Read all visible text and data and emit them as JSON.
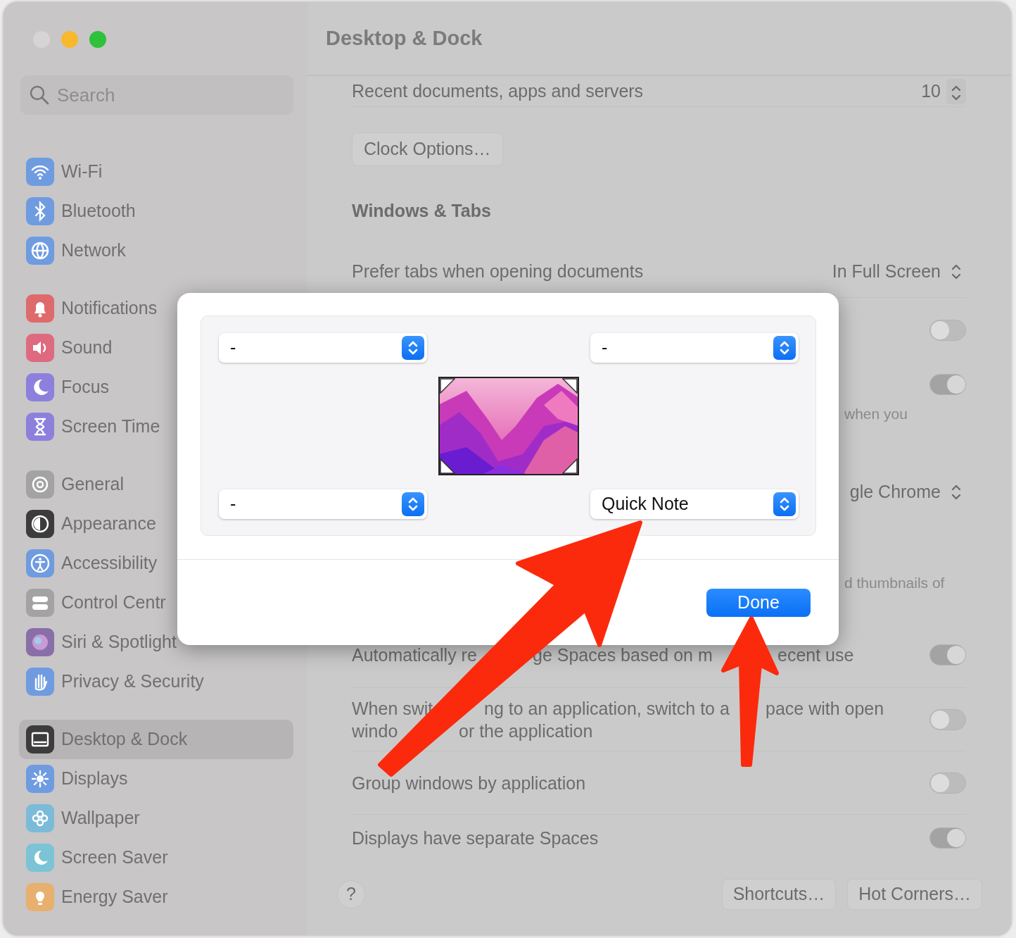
{
  "window": {
    "title": "Desktop & Dock"
  },
  "sidebar": {
    "search": {
      "placeholder": "Search"
    },
    "groups": [
      {
        "items": [
          {
            "label": "Wi-Fi",
            "color": "#6f9be0",
            "selected": false
          },
          {
            "label": "Bluetooth",
            "color": "#6f9be0",
            "selected": false
          },
          {
            "label": "Network",
            "color": "#6f9be0",
            "selected": false
          }
        ]
      },
      {
        "items": [
          {
            "label": "Notifications",
            "color": "#df6a6c",
            "selected": false
          },
          {
            "label": "Sound",
            "color": "#df6a80",
            "selected": false
          },
          {
            "label": "Focus",
            "color": "#8c80dc",
            "selected": false
          },
          {
            "label": "Screen Time",
            "color": "#8c80dc",
            "selected": false
          }
        ]
      },
      {
        "items": [
          {
            "label": "General",
            "color": "#a3a3a3",
            "selected": false
          },
          {
            "label": "Appearance",
            "color": "#3c3c3c",
            "selected": false
          },
          {
            "label": "Accessibility",
            "color": "#6f9be0",
            "selected": false
          },
          {
            "label": "Control Centr",
            "color": "#a3a3a3",
            "selected": false
          },
          {
            "label": "Siri & Spotlight",
            "color": "#8a6ea8",
            "selected": false
          },
          {
            "label": "Privacy & Security",
            "color": "#6f9be0",
            "selected": false
          }
        ]
      },
      {
        "items": [
          {
            "label": "Desktop & Dock",
            "color": "#3c3c3c",
            "selected": true
          },
          {
            "label": "Displays",
            "color": "#6f9be0",
            "selected": false
          },
          {
            "label": "Wallpaper",
            "color": "#7bbbd8",
            "selected": false
          },
          {
            "label": "Screen Saver",
            "color": "#7cc3d6",
            "selected": false
          },
          {
            "label": "Energy Saver",
            "color": "#e8b06e",
            "selected": false
          }
        ]
      }
    ]
  },
  "settings": [
    {
      "kind": "stepper",
      "label": "Recent documents, apps and servers",
      "value": "10"
    },
    {
      "kind": "button",
      "label": "Clock Options…"
    },
    {
      "kind": "heading",
      "label": "Windows & Tabs"
    },
    {
      "kind": "popup",
      "label": "Prefer tabs when opening documents",
      "value": "In Full Screen"
    },
    {
      "kind": "toggle",
      "on": false
    },
    {
      "kind": "toggle",
      "on": true,
      "label_tail": "when you"
    },
    {
      "kind": "popup",
      "value": "gle Chrome"
    },
    {
      "kind": "note",
      "label_tail": "d thumbnails of"
    },
    {
      "kind": "toggle",
      "label_lines": [
        [
          "Automatically re",
          "ge Spaces based on m",
          "ecent use"
        ]
      ],
      "on": true
    },
    {
      "kind": "toggle",
      "label_lines": [
        [
          "When swit",
          "ng to an application, switch to a",
          "pace with open"
        ],
        [
          "windo",
          "or the application"
        ]
      ],
      "on": false
    },
    {
      "kind": "toggle",
      "label": "Group windows by application",
      "on": false
    },
    {
      "kind": "toggle",
      "label": "Displays have separate Spaces",
      "on": true
    }
  ],
  "footer": {
    "help": "?",
    "buttons": [
      "Shortcuts…",
      "Hot Corners…"
    ]
  },
  "dialog": {
    "corners": [
      {
        "value": "-"
      },
      {
        "value": "-"
      },
      {
        "value": "-"
      },
      {
        "value": "Quick Note"
      }
    ],
    "button": "Done"
  },
  "annotations": [
    {
      "kind": "arrow"
    },
    {
      "kind": "arrow"
    }
  ]
}
